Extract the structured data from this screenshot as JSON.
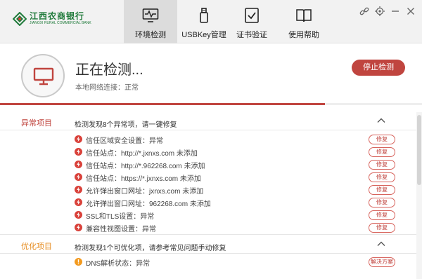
{
  "header": {
    "logo_cn": "江西农商银行",
    "logo_en": "JIANGXI RURAL COMMERCIAL BANK",
    "tabs": [
      {
        "label": "环境检测",
        "icon": "monitor-pulse-icon",
        "active": true
      },
      {
        "label": "USBKey管理",
        "icon": "usb-key-icon",
        "active": false
      },
      {
        "label": "证书验证",
        "icon": "certificate-check-icon",
        "active": false
      },
      {
        "label": "使用帮助",
        "icon": "book-icon",
        "active": false
      }
    ],
    "window_controls": [
      "link-icon",
      "settings-icon",
      "minimize-icon",
      "close-icon"
    ]
  },
  "status": {
    "title": "正在检测...",
    "subtitle": "本地网络连接：正常",
    "stop_label": "停止检测",
    "progress": 0.77
  },
  "colors": {
    "accent": "#c0453f",
    "warning": "#f39a1f",
    "brand": "#1f7a3a"
  },
  "sections": {
    "abnormal": {
      "title": "异常项目",
      "desc": "检测发现8个异常项，请一键修复",
      "items": [
        {
          "text": "信任区域安全设置：异常",
          "action": "修复"
        },
        {
          "text": "信任站点：http://*.jxnxs.com 未添加",
          "action": "修复"
        },
        {
          "text": "信任站点：http://*.962268.com 未添加",
          "action": "修复"
        },
        {
          "text": "信任站点：https://*.jxnxs.com 未添加",
          "action": "修复"
        },
        {
          "text": "允许弹出窗口网址：jxnxs.com 未添加",
          "action": "修复"
        },
        {
          "text": "允许弹出窗口网址：962268.com 未添加",
          "action": "修复"
        },
        {
          "text": "SSL和TLS设置：异常",
          "action": "修复"
        },
        {
          "text": "兼容性视图设置：异常",
          "action": "修复"
        }
      ]
    },
    "optimize": {
      "title": "优化项目",
      "desc": "检测发现1个可优化项，请参考常见问题手动修复",
      "items": [
        {
          "text": "DNS解析状态：异常",
          "action": "解决方案"
        }
      ]
    }
  }
}
